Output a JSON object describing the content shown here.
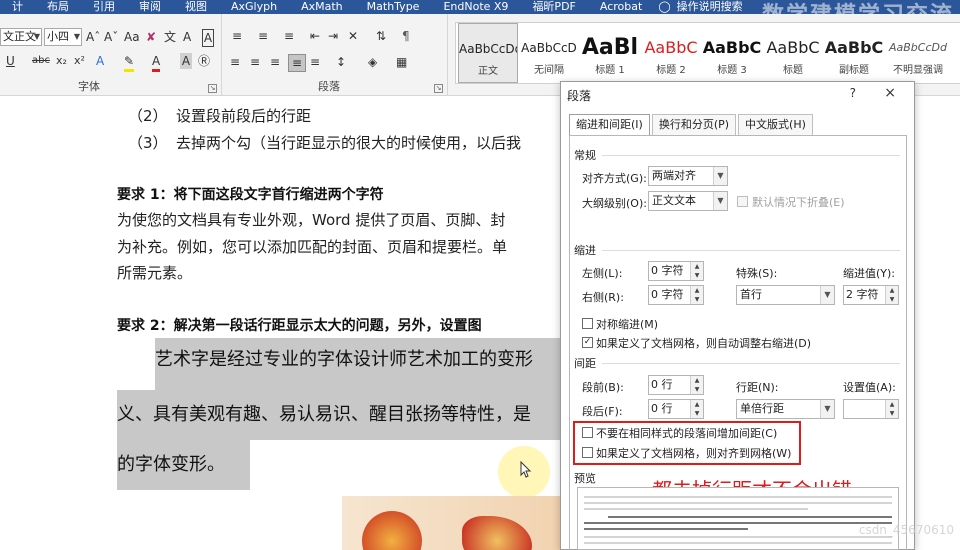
{
  "menubar": {
    "items": [
      "计",
      "布局",
      "引用",
      "审阅",
      "视图",
      "AxGlyph",
      "AxMath",
      "MathType",
      "EndNote X9",
      "福昕PDF",
      "Acrobat"
    ],
    "search_label": "操作说明搜索",
    "watermark": "数学建模学习交流",
    "bg_color": "#2b579a"
  },
  "ribbon": {
    "font_name": "文正文",
    "font_size": "小四",
    "font_group_label": "字体",
    "para_group_label": "段落",
    "styles": [
      {
        "sample": "AaBbCcDd",
        "name": "正文",
        "color": "#222222",
        "size": "12px",
        "bold": false,
        "active": true
      },
      {
        "sample": "AaBbCcD",
        "name": "无间隔",
        "color": "#222222",
        "size": "12px",
        "bold": false,
        "active": false
      },
      {
        "sample": "AaBl",
        "name": "标题 1",
        "color": "#111111",
        "size": "22px",
        "bold": true,
        "active": false
      },
      {
        "sample": "AaBbC",
        "name": "标题 2",
        "color": "#e01b1b",
        "size": "16px",
        "bold": false,
        "active": false
      },
      {
        "sample": "AaBbC",
        "name": "标题 3",
        "color": "#111111",
        "size": "16px",
        "bold": true,
        "active": false
      },
      {
        "sample": "AaBbC",
        "name": "标题",
        "color": "#222222",
        "size": "16px",
        "bold": false,
        "active": false
      },
      {
        "sample": "AaBbC",
        "name": "副标题",
        "color": "#222222",
        "size": "16px",
        "bold": true,
        "active": false
      },
      {
        "sample": "AaBbCcDd",
        "name": "不明显强调",
        "color": "#555555",
        "size": "11px",
        "bold": false,
        "active": false
      }
    ]
  },
  "document": {
    "list": [
      {
        "num": "（2）",
        "text": "设置段前段后的行距"
      },
      {
        "num": "（3）",
        "text": "去掉两个勾（当行距显示的很大的时候使用，以后我"
      }
    ],
    "req1": "要求 1：将下面这段文字首行缩进两个字符",
    "body_lines": [
      "为使您的文档具有专业外观，Word 提供了页眉、页脚、封",
      "为补充。例如，您可以添加匹配的封面、页眉和提要栏。单",
      "所需元素。"
    ],
    "req2": "要求 2：解决第一段话行距显示太大的问题，另外，设置图",
    "art_lines": [
      "艺术字是经过专业的字体设计师艺术加工的变形",
      "义、具有美观有趣、易认易识、醒目张扬等特性，是",
      "的字体变形。"
    ]
  },
  "dialog": {
    "title": "段落",
    "help": "?",
    "close": "×",
    "tabs": [
      "缩进和间距(I)",
      "换行和分页(P)",
      "中文版式(H)"
    ],
    "general": {
      "section": "常规",
      "align_label": "对齐方式(G):",
      "align_value": "两端对齐",
      "outline_label": "大纲级别(O):",
      "outline_value": "正文文本",
      "collapse_label": "默认情况下折叠(E)"
    },
    "indent": {
      "section": "缩进",
      "left_label": "左侧(L):",
      "left_value": "0 字符",
      "right_label": "右侧(R):",
      "right_value": "0 字符",
      "special_label": "特殊(S):",
      "special_value": "首行",
      "by_label": "缩进值(Y):",
      "by_value": "2 字符",
      "mirror_label": "对称缩进(M)",
      "autoadjust_label": "如果定义了文档网格，则自动调整右缩进(D)"
    },
    "spacing": {
      "section": "间距",
      "before_label": "段前(B):",
      "before_value": "0 行",
      "after_label": "段后(F):",
      "after_value": "0 行",
      "line_label": "行距(N):",
      "line_value": "单倍行距",
      "at_label": "设置值(A):",
      "at_value": "",
      "nospace_label": "不要在相同样式的段落间增加间距(C)",
      "snapgrid_label": "如果定义了文档网格，则对齐到网格(W)"
    },
    "preview_label": "预览"
  },
  "annotation": "都去掉行距才不会出错",
  "watermark_bottom": "csdn_45670610",
  "accent_red": "#e01b1b"
}
